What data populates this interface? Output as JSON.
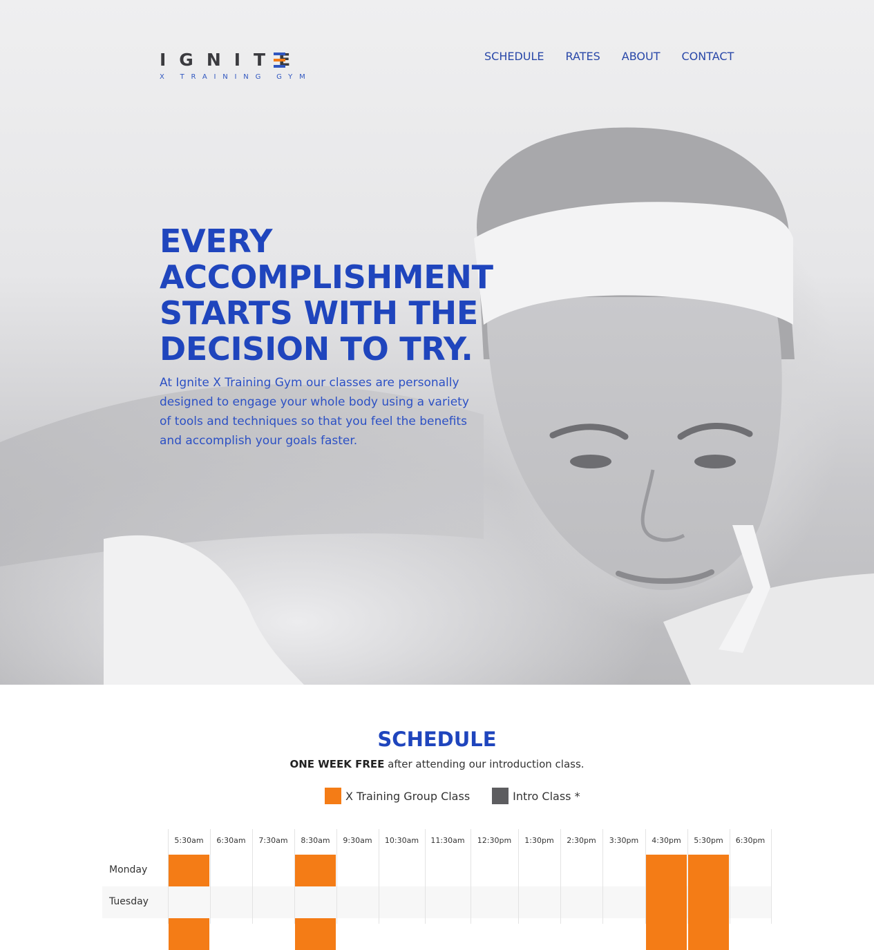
{
  "brand": {
    "name": "IGNITE",
    "tagline": "X TRAINING GYM",
    "accent_orange": "#f47c16",
    "accent_blue": "#1f45bd"
  },
  "nav": {
    "items": [
      {
        "label": "SCHEDULE"
      },
      {
        "label": "RATES"
      },
      {
        "label": "ABOUT"
      },
      {
        "label": "CONTACT"
      }
    ]
  },
  "hero": {
    "headline": "EVERY ACCOMPLISHMENT STARTS WITH THE DECISION TO TRY.",
    "intro": "At Ignite X Training Gym our classes are personally designed to engage your whole body using a variety of tools and techniques so that you feel the benefits and accomplish your goals faster."
  },
  "schedule": {
    "title": "SCHEDULE",
    "offer_bold": "ONE WEEK FREE",
    "offer_rest": " after attending our introduction class.",
    "legend": [
      {
        "label": "X Training Group Class",
        "color": "#f47c16"
      },
      {
        "label": "Intro Class *",
        "color": "#5d5d60"
      }
    ],
    "times": [
      "5:30am",
      "6:30am",
      "7:30am",
      "8:30am",
      "9:30am",
      "10:30am",
      "11:30am",
      "12:30pm",
      "1:30pm",
      "2:30pm",
      "3:30pm",
      "4:30pm",
      "5:30pm",
      "6:30pm"
    ],
    "days": [
      {
        "label": "Monday",
        "classes": [
          {
            "time": "5:30am",
            "type": "group"
          },
          {
            "time": "8:30am",
            "type": "group"
          },
          {
            "time": "4:30pm",
            "type": "group"
          },
          {
            "time": "5:30pm",
            "type": "group"
          }
        ]
      },
      {
        "label": "Tuesday",
        "classes": [
          {
            "time": "4:30pm",
            "type": "group"
          },
          {
            "time": "5:30pm",
            "type": "group"
          }
        ]
      },
      {
        "label": "",
        "classes": [
          {
            "time": "5:30am",
            "type": "group"
          },
          {
            "time": "8:30am",
            "type": "group"
          },
          {
            "time": "4:30pm",
            "type": "group"
          },
          {
            "time": "5:30pm",
            "type": "group"
          }
        ]
      }
    ]
  }
}
